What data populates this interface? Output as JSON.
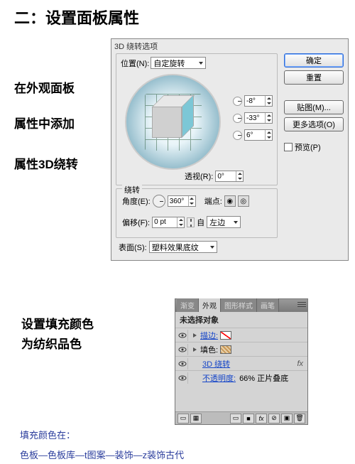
{
  "heading": "二：设置面板属性",
  "descriptions": {
    "d1": "在外观面板",
    "d2": "属性中添加",
    "d3": "属性3D绕转",
    "d4": "设置填充颜色",
    "d5": "为纺织品色"
  },
  "footer": {
    "f1": "填充颜色在：",
    "f2": "色板—色板库—t图案—装饰—z装饰古代"
  },
  "dialog": {
    "title": "3D 绕转选项",
    "position_label": "位置(N):",
    "position_value": "自定旋转",
    "angle_x": "-8°",
    "angle_y": "-33°",
    "angle_z": "6°",
    "perspective_label": "透视(R):",
    "perspective_value": "0°",
    "revolve_group": "绕转",
    "angle_label": "角度(E):",
    "angle_value": "360°",
    "cap_label": "端点:",
    "offset_label": "偏移(F):",
    "offset_value": "0 pt",
    "from_label": "自",
    "from_value": "左边",
    "surface_label": "表面(S):",
    "surface_value": "塑料效果底纹",
    "buttons": {
      "ok": "确定",
      "reset": "重置",
      "map": "贴图(M)...",
      "more": "更多选项(O)",
      "preview": "预览(P)"
    }
  },
  "panel": {
    "tabs": [
      "渐变",
      "外观",
      "图形样式",
      "画笔"
    ],
    "active_tab": 1,
    "header": "未选择对象",
    "rows": {
      "stroke_label": "描边:",
      "fill_label": "填色:",
      "revolve_label": "3D 绕转",
      "opacity_label": "不透明度:",
      "opacity_value": "66% 正片叠底"
    },
    "fx_label": "fx"
  }
}
